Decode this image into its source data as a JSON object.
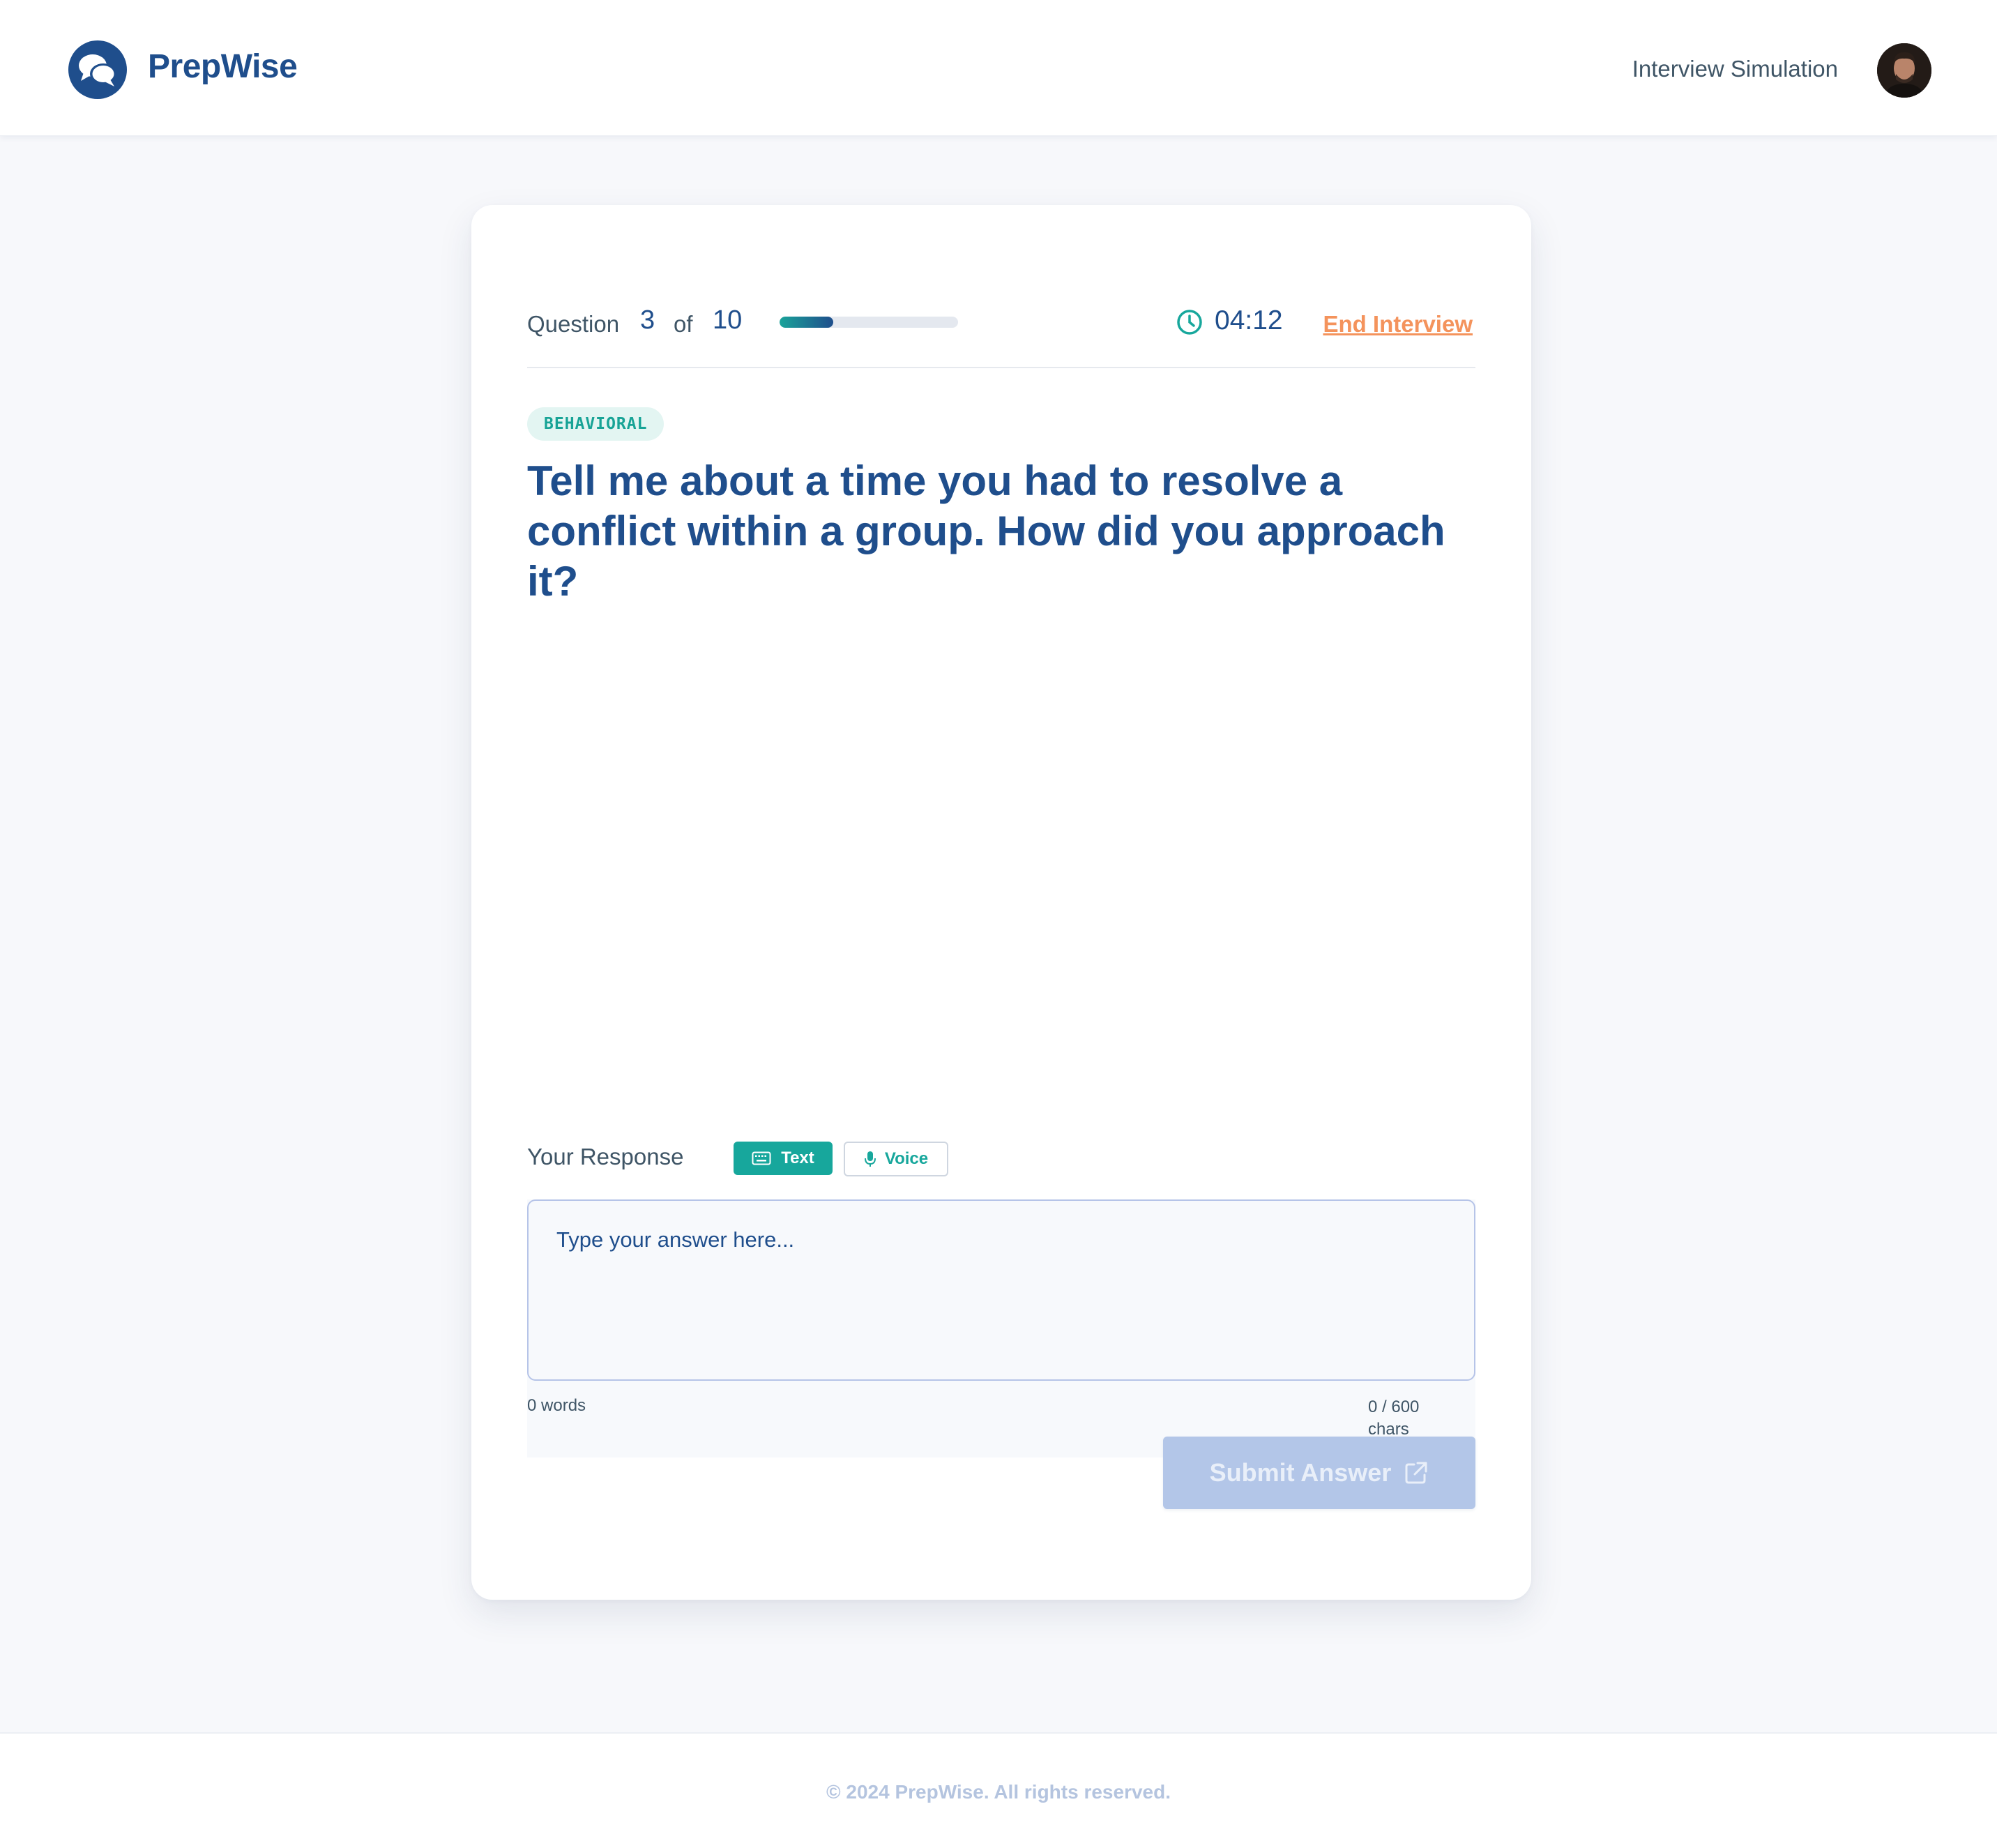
{
  "header": {
    "brand": "PrepWise",
    "nav_title": "Interview Simulation"
  },
  "progress": {
    "question_label": "Question",
    "current": "3",
    "of_label": "of",
    "total": "10",
    "fraction_complete": 0.3,
    "timer": "04:12",
    "end_label": "End Interview"
  },
  "question": {
    "category": "BEHAVIORAL",
    "text": "Tell me about a time you had to resolve a conflict within a group. How did you approach it?"
  },
  "response": {
    "label": "Your Response",
    "mode_text_label": "Text",
    "mode_voice_label": "Voice",
    "active_mode": "Text",
    "placeholder": "Type your answer here...",
    "value": "",
    "word_count": "0 words",
    "char_count": "0 / 600 chars",
    "submit_label": "Submit Answer"
  },
  "footer": {
    "copyright": "© 2024 PrepWise. All rights reserved."
  },
  "colors": {
    "brand": "#1f4e8c",
    "accent": "#17a79c",
    "warning": "#f4935c",
    "submit_disabled": "#b3c6e8"
  }
}
